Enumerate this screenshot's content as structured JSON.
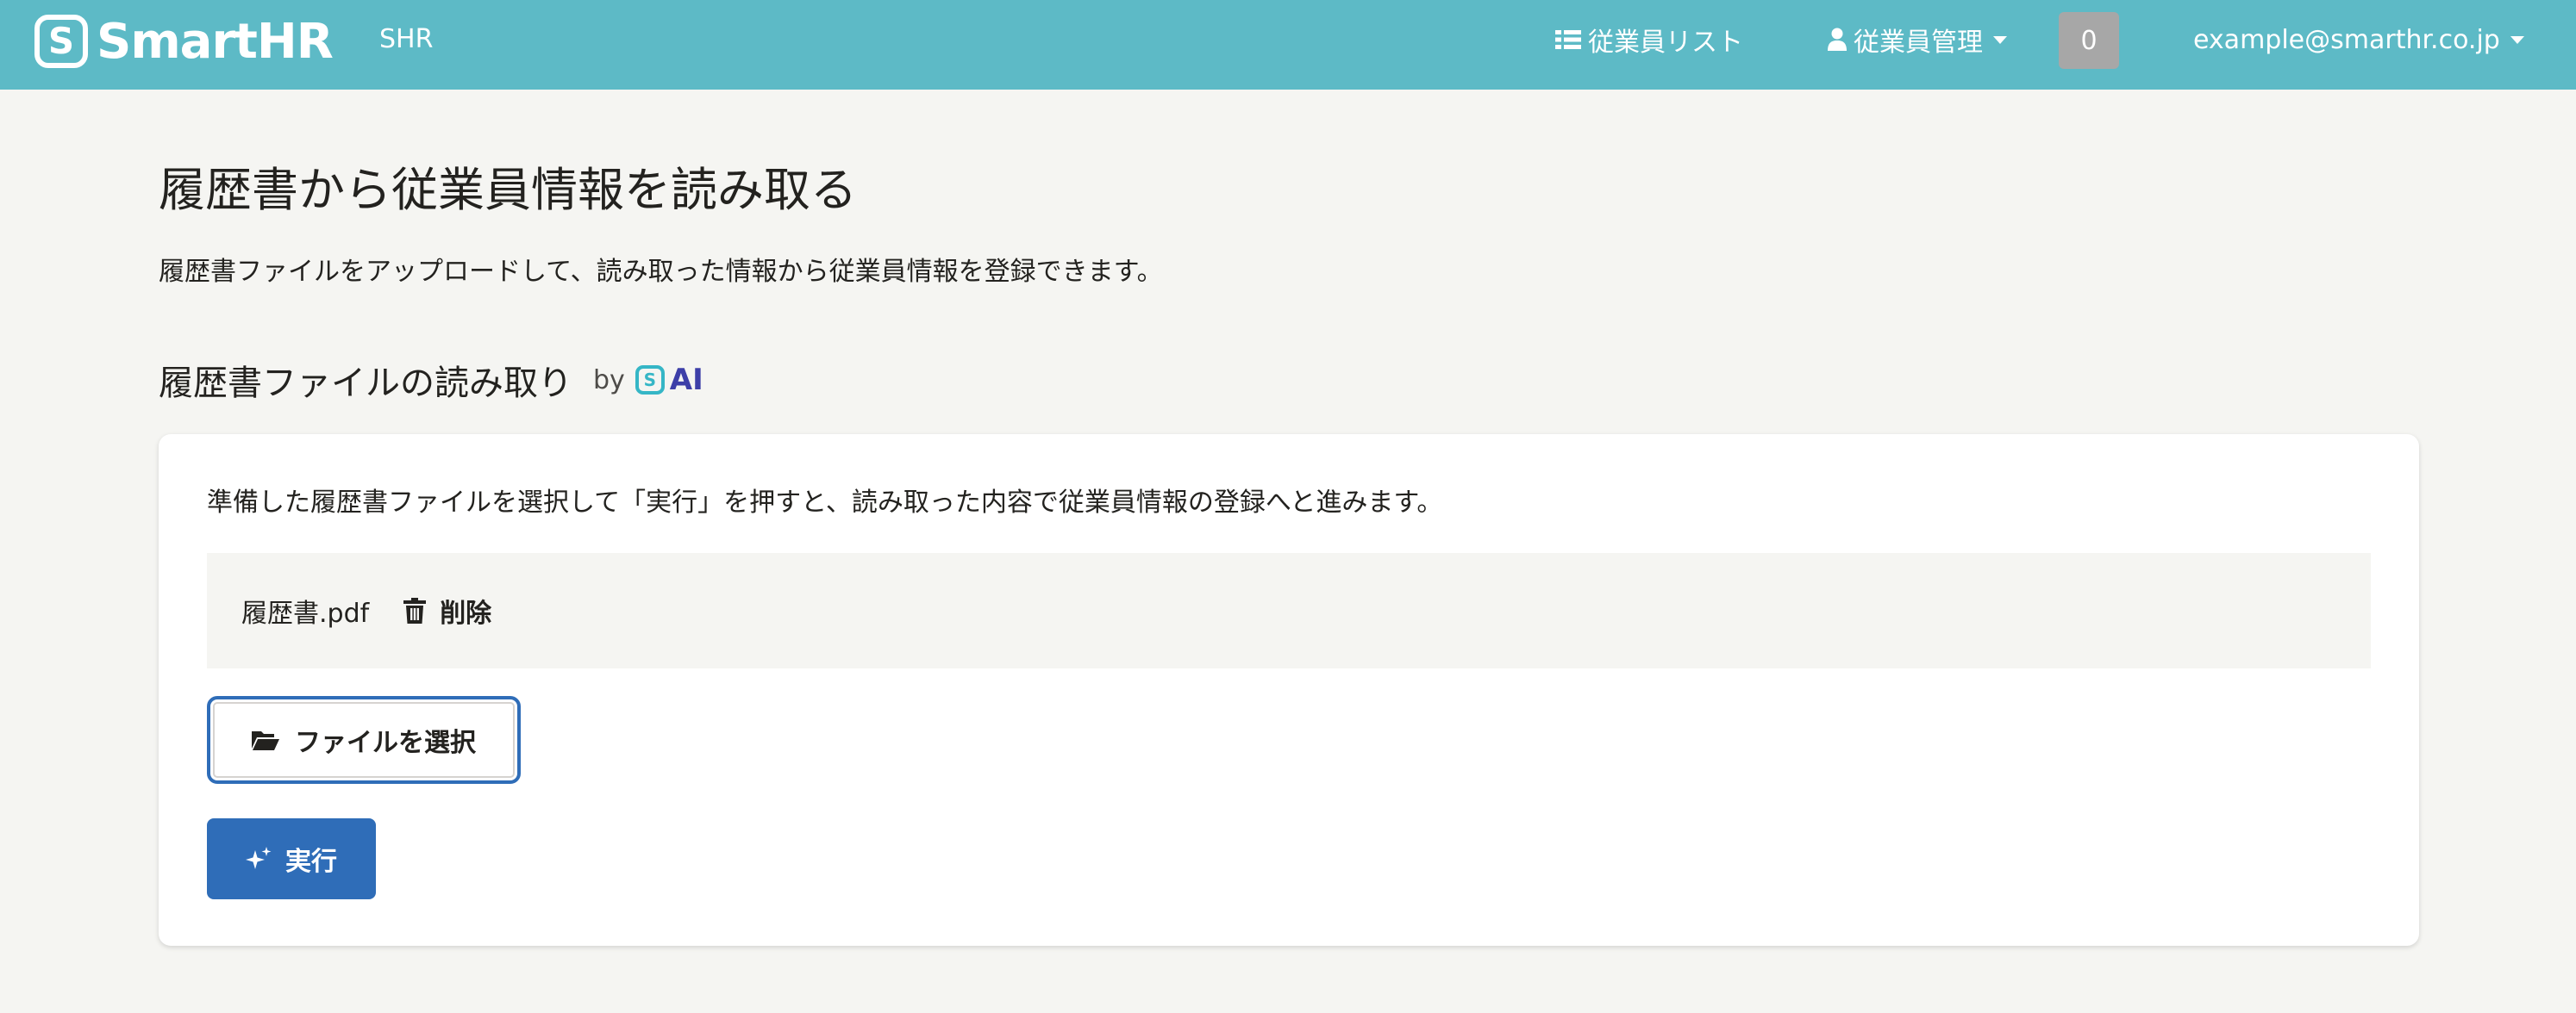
{
  "header": {
    "logo_mark": "S",
    "logo_text": "SmartHR",
    "tenant": "SHR",
    "nav_employee_list": "従業員リスト",
    "nav_employee_manage": "従業員管理",
    "notification_count": "0",
    "user_email": "example@smarthr.co.jp",
    "icons": [
      "list-icon",
      "user-icon",
      "caret-down-icon"
    ],
    "bar_color": "#5dbac6"
  },
  "page": {
    "title": "履歴書から従業員情報を読み取る",
    "description": "履歴書ファイルをアップロードして、読み取った情報から従業員情報を登録できます。"
  },
  "section": {
    "title": "履歴書ファイルの読み取り",
    "by_label": "by",
    "ai_mark": "S",
    "ai_label": "AI"
  },
  "card": {
    "instruction": "準備した履歴書ファイルを選択して「実行」を押すと、読み取った内容で従業員情報の登録へと進みます。",
    "file_name": "履歴書.pdf",
    "delete_label": "削除",
    "select_file_label": "ファイルを選択",
    "run_label": "実行",
    "icons": [
      "trash-icon",
      "folder-open-icon",
      "sparkle-icon"
    ],
    "primary_color": "#2f6db8"
  }
}
